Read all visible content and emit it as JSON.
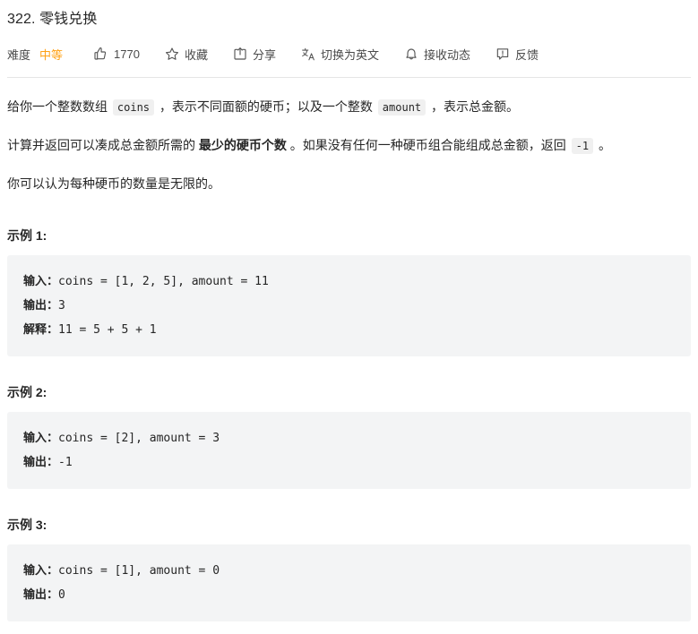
{
  "problem": {
    "number": "322.",
    "title": "零钱兑换",
    "full_title": "322. 零钱兑换"
  },
  "toolbar": {
    "difficulty_label": "难度",
    "difficulty_value": "中等",
    "difficulty_color": "#ffa116",
    "like_icon": "thumbs-up-icon",
    "like_count": "1770",
    "favorite_icon": "star-icon",
    "favorite_label": "收藏",
    "share_icon": "share-icon",
    "share_label": "分享",
    "translate_icon": "translate-icon",
    "translate_label": "切换为英文",
    "notify_icon": "bell-icon",
    "notify_label": "接收动态",
    "feedback_icon": "feedback-icon",
    "feedback_label": "反馈"
  },
  "description": {
    "p1_a": "给你一个整数数组 ",
    "p1_code1": "coins",
    "p1_b": " ，表示不同面额的硬币；以及一个整数 ",
    "p1_code2": "amount",
    "p1_c": " ，表示总金额。",
    "p2_a": "计算并返回可以凑成总金额所需的 ",
    "p2_strong": "最少的硬币个数",
    "p2_b": " 。如果没有任何一种硬币组合能组成总金额，返回 ",
    "p2_code": "-1",
    "p2_c": " 。",
    "p3": "你可以认为每种硬币的数量是无限的。"
  },
  "examples": [
    {
      "heading": "示例 1:",
      "input_label": "输入：",
      "input_value": "coins = [1, 2, 5], amount = 11",
      "output_label": "输出：",
      "output_value": "3",
      "explain_label": "解释：",
      "explain_value": "11 = 5 + 5 + 1"
    },
    {
      "heading": "示例 2:",
      "input_label": "输入：",
      "input_value": "coins = [2], amount = 3",
      "output_label": "输出：",
      "output_value": "-1",
      "explain_label": "",
      "explain_value": ""
    },
    {
      "heading": "示例 3:",
      "input_label": "输入：",
      "input_value": "coins = [1], amount = 0",
      "output_label": "输出：",
      "output_value": "0",
      "explain_label": "",
      "explain_value": ""
    }
  ]
}
